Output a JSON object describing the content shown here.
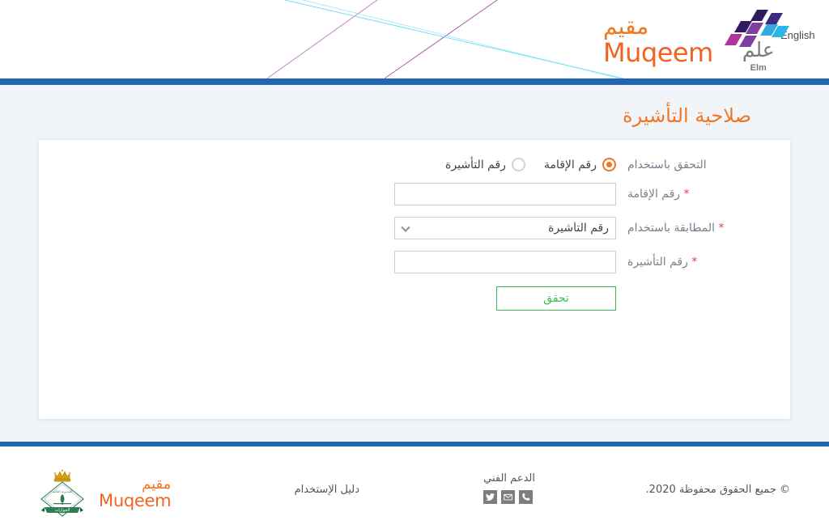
{
  "header": {
    "language_link": "English",
    "brand": {
      "muqeem_ar": "مقيم",
      "muqeem_en": "Muqeem",
      "elm_ar": "علم",
      "elm_en": "Elm"
    },
    "accent_orange": "#f07722",
    "bar_blue": "#2266b2"
  },
  "main": {
    "page_title": "صلاحية التأشيرة",
    "form": {
      "verify_by": {
        "label": "التحقق باستخدام",
        "options": [
          {
            "label": "رقم الإقامة",
            "selected": true
          },
          {
            "label": "رقم التأشيرة",
            "selected": false
          }
        ]
      },
      "iqama_number": {
        "label": "رقم الإقامة",
        "required_marker": "*",
        "value": "",
        "placeholder": ""
      },
      "match_by": {
        "label": "المطابقة باستخدام",
        "required_marker": "*",
        "selected": "رقم التأشيرة",
        "options": [
          "رقم التأشيرة"
        ]
      },
      "visa_number": {
        "label": "رقم التأشيرة",
        "required_marker": "*",
        "value": "",
        "placeholder": ""
      },
      "submit_label": "تحقق",
      "submit_color": "#3bbd54"
    }
  },
  "footer": {
    "copyright": "© جميع الحقوق محفوظة 2020.",
    "support_title": "الدعم الفني",
    "social": [
      {
        "name": "twitter-icon"
      },
      {
        "name": "email-icon"
      },
      {
        "name": "phone-icon"
      }
    ],
    "user_guide": "دليل الإستخدام",
    "brand": {
      "muqeem_ar": "مقيم",
      "muqeem_en": "Muqeem",
      "emblem_ribbon": "الجوازات"
    }
  }
}
